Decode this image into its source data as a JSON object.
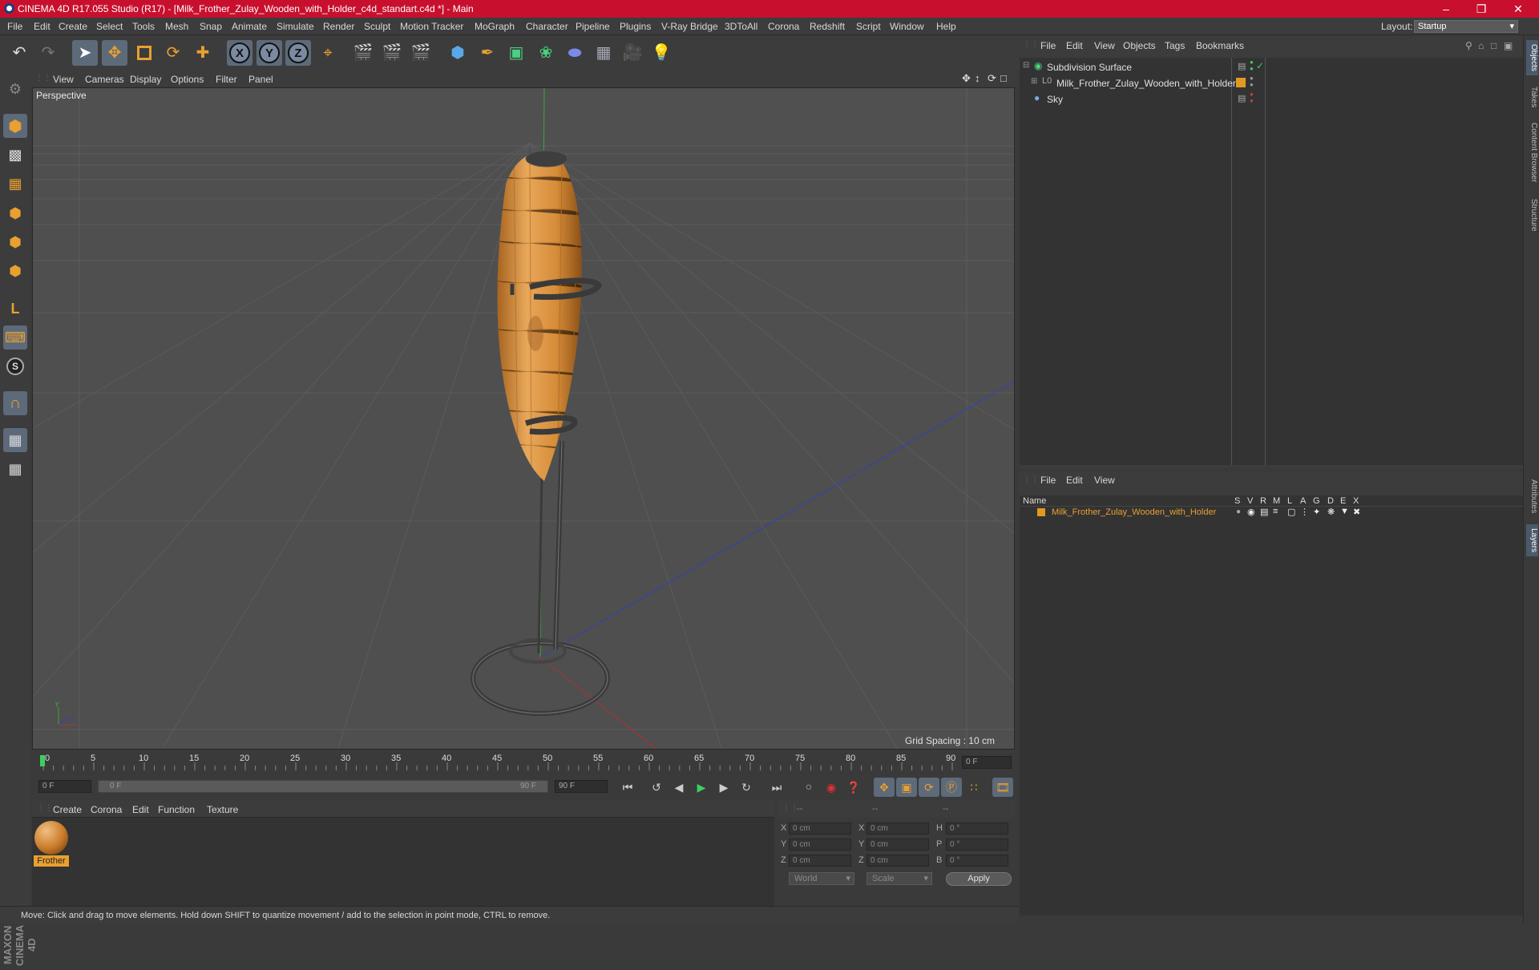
{
  "window": {
    "title": "CINEMA 4D R17.055 Studio (R17) - [Milk_Frother_Zulay_Wooden_with_Holder_c4d_standart.c4d *] - Main"
  },
  "menu": [
    "File",
    "Edit",
    "Create",
    "Select",
    "Tools",
    "Mesh",
    "Snap",
    "Animate",
    "Simulate",
    "Render",
    "Sculpt",
    "Motion Tracker",
    "MoGraph",
    "Character",
    "Pipeline",
    "Plugins",
    "V-Ray Bridge",
    "3DToAll",
    "Corona",
    "Redshift",
    "Script",
    "Window",
    "Help"
  ],
  "layout": {
    "label": "Layout:",
    "value": "Startup"
  },
  "viewport": {
    "menu": [
      "View",
      "Cameras",
      "Display",
      "Options",
      "Filter",
      "Panel"
    ],
    "camera_label": "Perspective",
    "grid_spacing": "Grid Spacing : 10 cm"
  },
  "timeline": {
    "ticks": [
      "0",
      "5",
      "10",
      "15",
      "20",
      "25",
      "30",
      "35",
      "40",
      "45",
      "50",
      "55",
      "60",
      "65",
      "70",
      "75",
      "80",
      "85",
      "90"
    ],
    "current_frame": "0 F",
    "start_field": "0 F",
    "range_start": "0 F",
    "range_end": "90 F",
    "end_field": "90 F"
  },
  "material_manager": {
    "menu": [
      "Create",
      "Corona",
      "Edit",
      "Function",
      "Texture"
    ],
    "materials": [
      {
        "name": "Frother"
      }
    ]
  },
  "coordinates": {
    "headers": [
      "--",
      "--",
      "--"
    ],
    "rows": [
      {
        "a_label": "X",
        "a_value": "0 cm",
        "b_label": "X",
        "b_value": "0 cm",
        "c_label": "H",
        "c_value": "0 °"
      },
      {
        "a_label": "Y",
        "a_value": "0 cm",
        "b_label": "Y",
        "b_value": "0 cm",
        "c_label": "P",
        "c_value": "0 °"
      },
      {
        "a_label": "Z",
        "a_value": "0 cm",
        "b_label": "Z",
        "b_value": "0 cm",
        "c_label": "B",
        "c_value": "0 °"
      }
    ],
    "space": "World",
    "mode": "Scale",
    "apply": "Apply"
  },
  "object_manager": {
    "menu": [
      "File",
      "Edit",
      "View",
      "Objects",
      "Tags",
      "Bookmarks"
    ],
    "objects": [
      {
        "name": "Subdivision Surface"
      },
      {
        "name": "Milk_Frother_Zulay_Wooden_with_Holder"
      },
      {
        "name": "Sky"
      }
    ]
  },
  "layer_manager": {
    "menu": [
      "File",
      "Edit",
      "View"
    ],
    "columns": [
      "Name",
      "S",
      "V",
      "R",
      "M",
      "L",
      "A",
      "G",
      "D",
      "E",
      "X"
    ],
    "layers": [
      {
        "name": "Milk_Frother_Zulay_Wooden_with_Holder",
        "color": "#e09a20"
      }
    ]
  },
  "right_tabs": [
    "Objects",
    "Takes",
    "Content Browser",
    "Structure",
    "Attributes",
    "Layers"
  ],
  "status": "Move: Click and drag to move elements. Hold down SHIFT to quantize movement / add to the selection in point mode, CTRL to remove.",
  "colors": {
    "titlebar": "#c8102e",
    "accent": "#e09a20",
    "wood": "#d8923c"
  }
}
